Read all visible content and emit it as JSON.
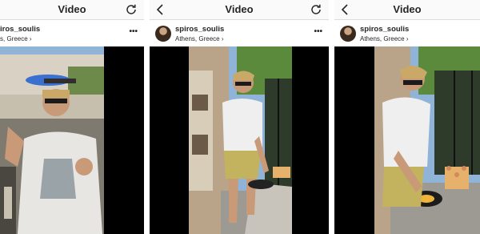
{
  "screens": [
    {
      "title": "Video",
      "username": "iros_soulis",
      "location": "s, Greece",
      "more": "•••",
      "nav_icon": "refresh-icon"
    },
    {
      "title": "Video",
      "username": "spiros_soulis",
      "location": "Athens, Greece",
      "more": "•••",
      "nav_icons": [
        "back-icon",
        "refresh-icon"
      ]
    },
    {
      "title": "Video",
      "username": "spiros_soulis",
      "location": "Athens, Greece",
      "nav_icon": "back-icon"
    }
  ],
  "colors": {
    "bar_bg": "#fafafa",
    "video_bg": "#000000",
    "text": "#262626"
  }
}
